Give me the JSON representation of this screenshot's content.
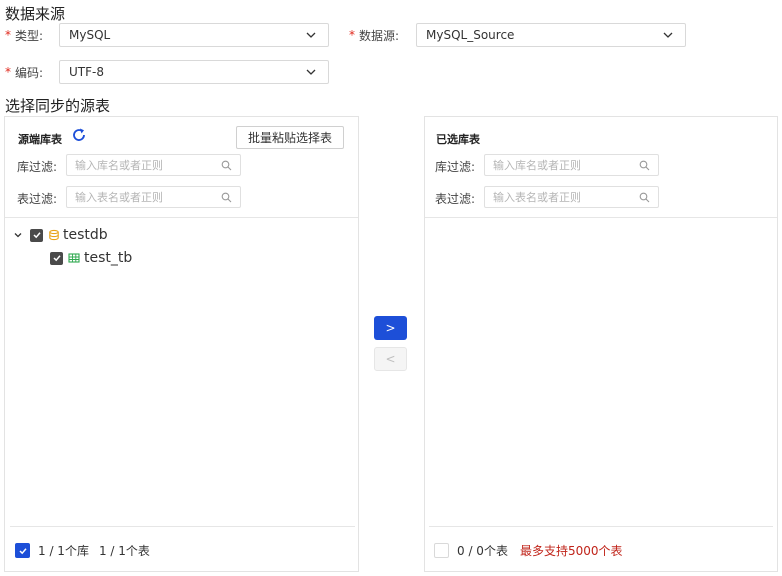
{
  "datasource": {
    "title": "数据来源",
    "type_label": "类型:",
    "type_value": "MySQL",
    "source_label": "数据源:",
    "source_value": "MySQL_Source",
    "encoding_label": "编码:",
    "encoding_value": "UTF-8",
    "required_mark": "*"
  },
  "select_tables": {
    "title": "选择同步的源表",
    "source_panel": {
      "title": "源端库表",
      "paste_button": "批量粘贴选择表",
      "db_filter_label": "库过滤:",
      "db_filter_placeholder": "输入库名或者正则",
      "table_filter_label": "表过滤:",
      "table_filter_placeholder": "输入表名或者正则",
      "tree": {
        "db_name": "testdb",
        "table_name": "test_tb"
      },
      "footer_db_count": "1 / 1个库",
      "footer_table_count": "1 / 1个表"
    },
    "transfer": {
      "right_label": ">",
      "left_label": "<"
    },
    "target_panel": {
      "title": "已选库表",
      "db_filter_label": "库过滤:",
      "db_filter_placeholder": "输入库名或者正则",
      "table_filter_label": "表过滤:",
      "table_filter_placeholder": "输入表名或者正则",
      "footer_table_count": "0 / 0个表",
      "limit_text": "最多支持5000个表"
    }
  },
  "colors": {
    "primary": "#1d4fd8",
    "required": "#e0281c",
    "limit": "#c0241a",
    "db_icon": "#e8a317",
    "table_icon": "#2fa84f"
  }
}
